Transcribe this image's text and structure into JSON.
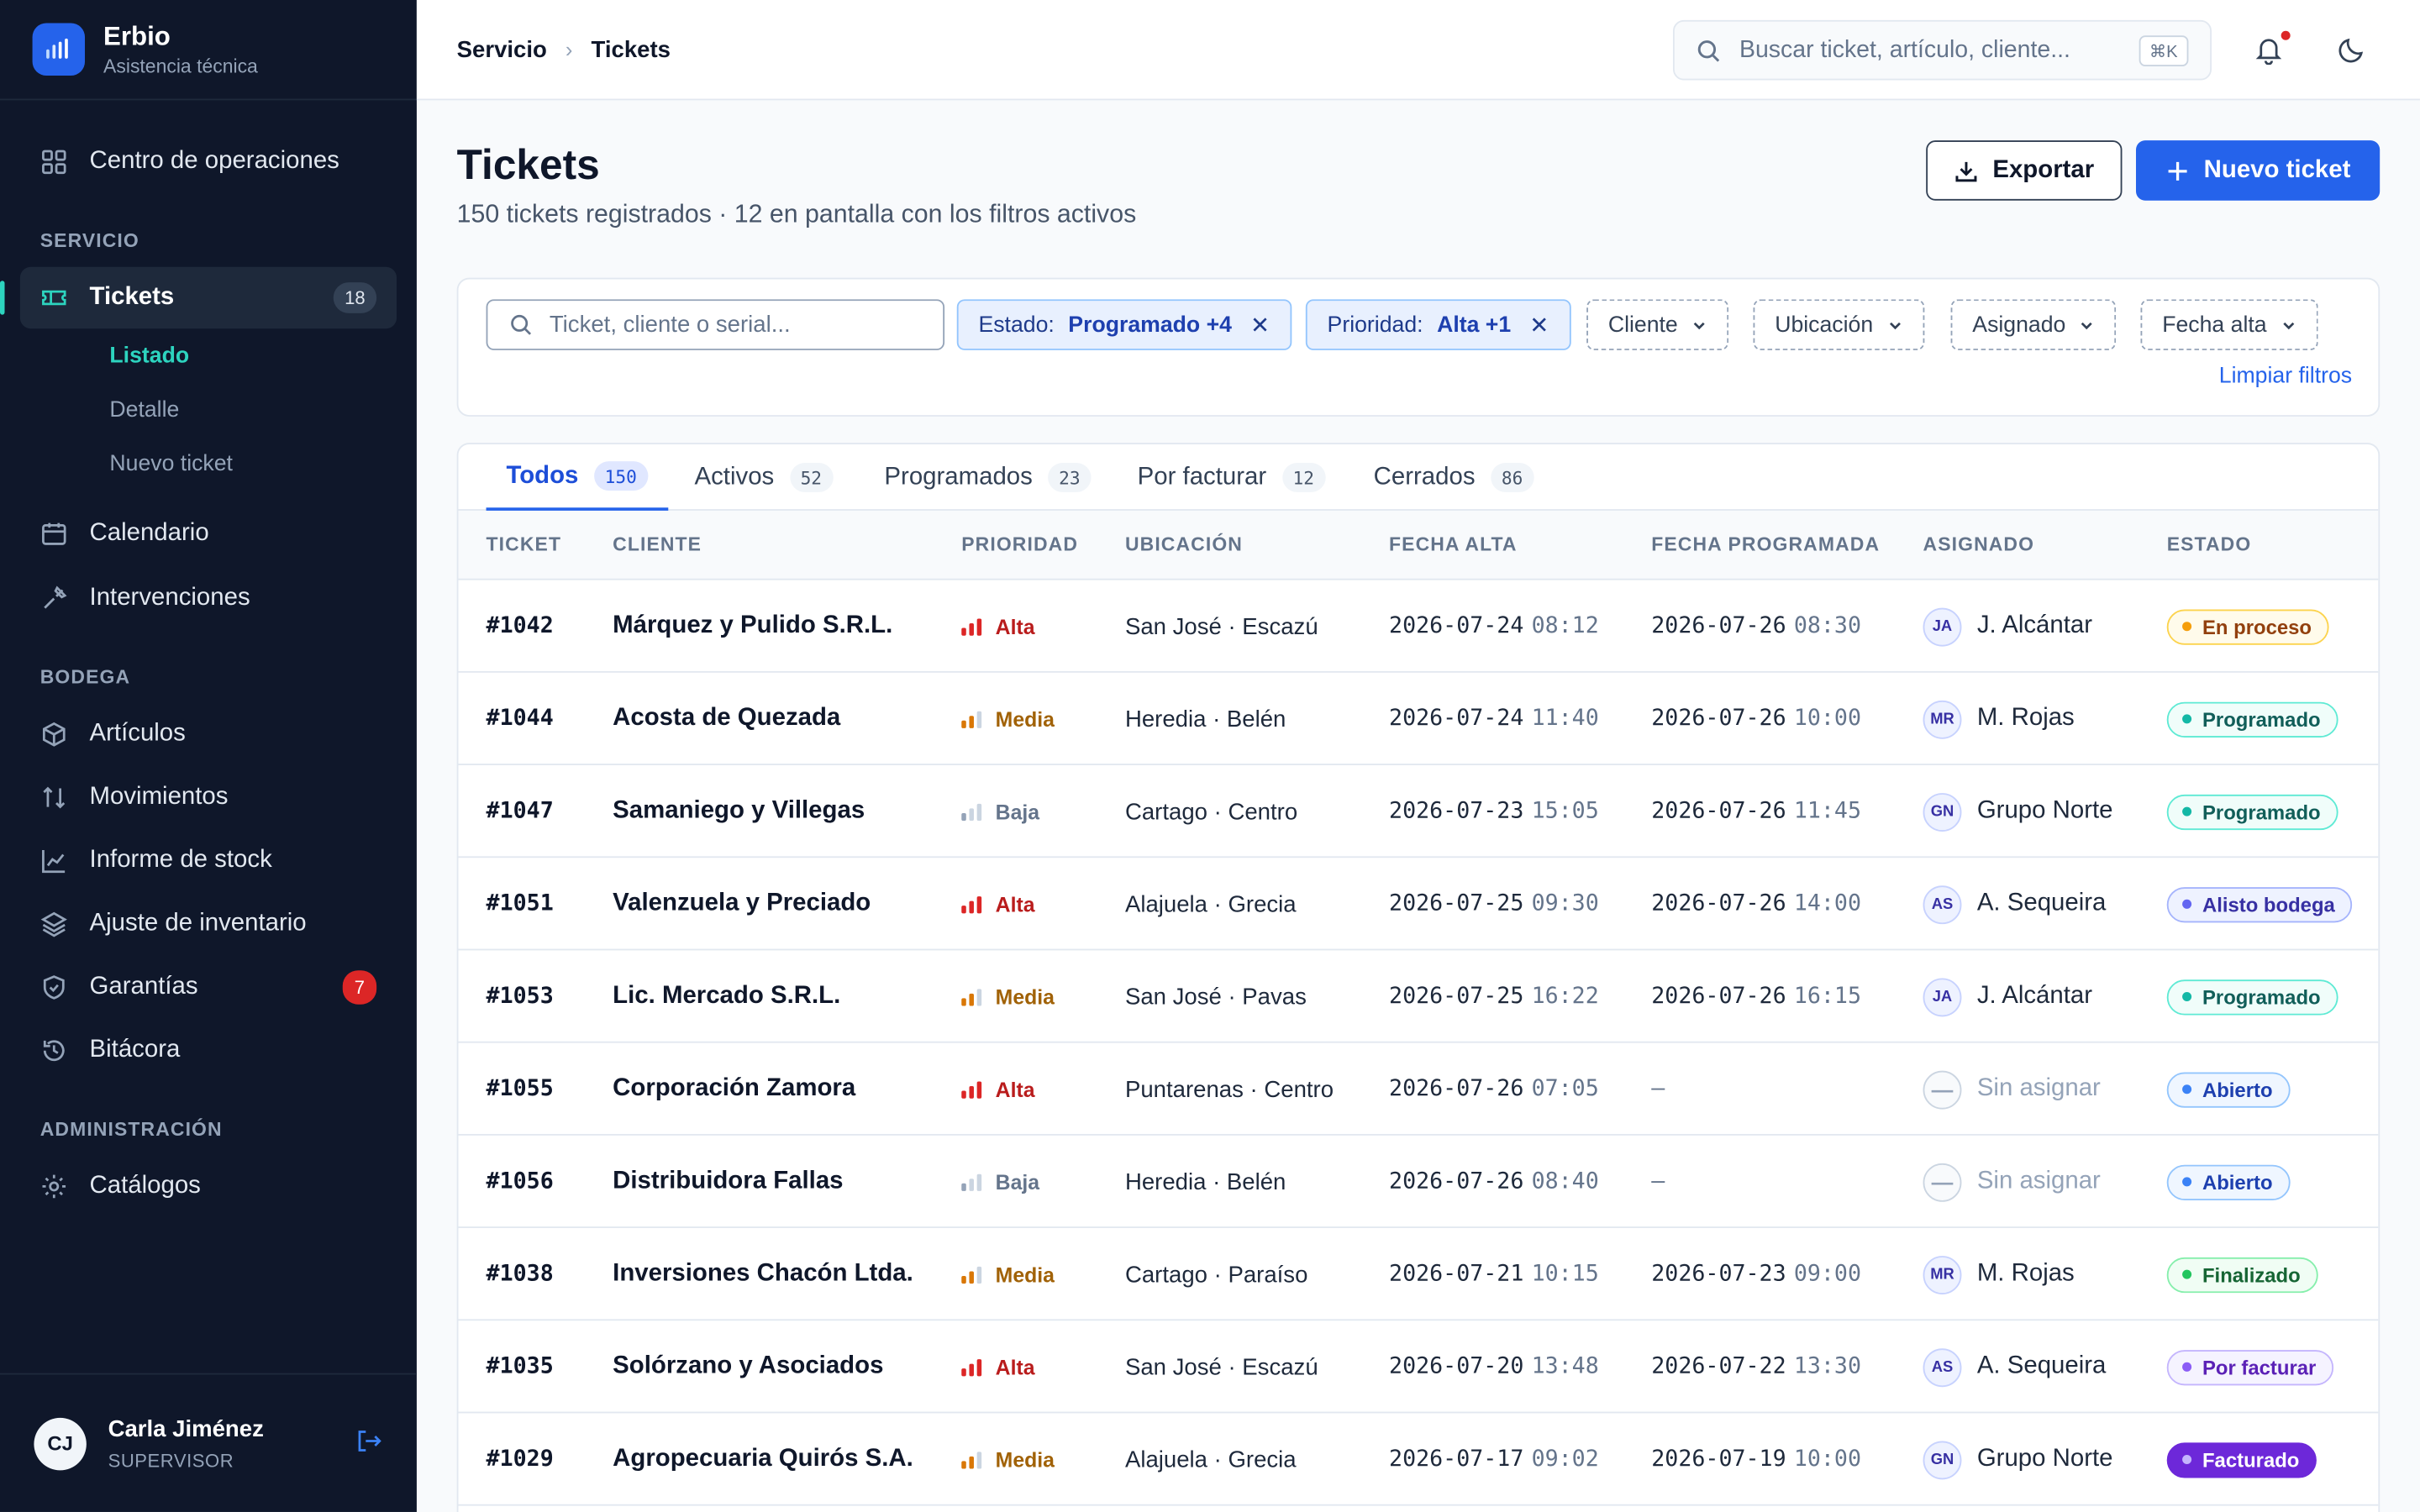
{
  "brand": {
    "name": "Erbio",
    "subtitle": "Asistencia técnica"
  },
  "sidebar": {
    "top_item": {
      "label": "Centro de operaciones",
      "icon": "grid-icon"
    },
    "sections": [
      {
        "title": "SERVICIO"
      },
      {
        "title": "BODEGA"
      },
      {
        "title": "ADMINISTRACIÓN"
      }
    ],
    "tickets": {
      "label": "Tickets",
      "count": "18",
      "icon": "ticket-icon",
      "sub": [
        {
          "label": "Listado"
        },
        {
          "label": "Detalle"
        },
        {
          "label": "Nuevo ticket"
        }
      ]
    },
    "servicio_items": [
      {
        "label": "Calendario",
        "icon": "calendar-icon"
      },
      {
        "label": "Intervenciones",
        "icon": "wrench-icon"
      }
    ],
    "bodega_items": [
      {
        "label": "Artículos",
        "icon": "box-icon"
      },
      {
        "label": "Movimientos",
        "icon": "arrows-updown-icon"
      },
      {
        "label": "Informe de stock",
        "icon": "line-chart-icon"
      },
      {
        "label": "Ajuste de inventario",
        "icon": "layers-icon"
      },
      {
        "label": "Garantías",
        "icon": "shield-icon",
        "badge": "7"
      },
      {
        "label": "Bitácora",
        "icon": "history-icon"
      }
    ],
    "admin_items": [
      {
        "label": "Catálogos",
        "icon": "gear-icon"
      }
    ],
    "user": {
      "initials": "CJ",
      "name": "Carla Jiménez",
      "role": "SUPERVISOR"
    }
  },
  "topbar": {
    "breadcrumb": [
      "Servicio",
      "Tickets"
    ],
    "search_placeholder": "Buscar ticket, artículo, cliente...",
    "shortcut": "⌘K"
  },
  "page": {
    "title": "Tickets",
    "subtitle": "150 tickets registrados · 12 en pantalla con los filtros activos",
    "export_label": "Exportar",
    "new_label": "Nuevo ticket"
  },
  "filters": {
    "search_placeholder": "Ticket, cliente o serial...",
    "active": [
      {
        "label": "Estado:",
        "value": "Programado +4"
      },
      {
        "label": "Prioridad:",
        "value": "Alta +1"
      }
    ],
    "dropdowns": [
      "Cliente",
      "Ubicación",
      "Asignado",
      "Fecha alta"
    ],
    "clear_label": "Limpiar filtros"
  },
  "tabs": [
    {
      "label": "Todos",
      "count": "150",
      "selected": true
    },
    {
      "label": "Activos",
      "count": "52"
    },
    {
      "label": "Programados",
      "count": "23"
    },
    {
      "label": "Por facturar",
      "count": "12"
    },
    {
      "label": "Cerrados",
      "count": "86"
    }
  ],
  "columns": [
    "TICKET",
    "CLIENTE",
    "PRIORIDAD",
    "UBICACIÓN",
    "FECHA ALTA",
    "FECHA PROGRAMADA",
    "ASIGNADO",
    "ESTADO"
  ],
  "colors": {
    "prio_alta": "#b91c1c",
    "prio_media": "#a16207",
    "prio_baja": "#64748b",
    "bar_alta": "#dc2626",
    "bar_media": "#d97706",
    "bar_baja": "#94a3b8"
  },
  "statuses": {
    "En proceso": {
      "bg": "#fffbeb",
      "border": "#fcd34d",
      "fg": "#92400e",
      "dot": "#f59e0b"
    },
    "Programado": {
      "bg": "#f0fdfa",
      "border": "#5eead4",
      "fg": "#115e59",
      "dot": "#14b8a6"
    },
    "Alisto bodega": {
      "bg": "#eef2ff",
      "border": "#a5b4fc",
      "fg": "#3730a3",
      "dot": "#6366f1"
    },
    "Abierto": {
      "bg": "#eff6ff",
      "border": "#93c5fd",
      "fg": "#1e40af",
      "dot": "#3b82f6"
    },
    "Finalizado": {
      "bg": "#f0fdf4",
      "border": "#86efac",
      "fg": "#166534",
      "dot": "#22c55e"
    },
    "Por facturar": {
      "bg": "#f5f3ff",
      "border": "#c4b5fd",
      "fg": "#5b21b6",
      "dot": "#8b5cf6"
    },
    "Facturado": {
      "bg": "#6d28d9",
      "border": "#6d28d9",
      "fg": "#ffffff",
      "dot": "#c4b5fd"
    }
  },
  "rows": [
    {
      "id": "#1042",
      "client": "Márquez y Pulido S.R.L.",
      "priority": "Alta",
      "location": "San José · Escazú",
      "created_date": "2026-07-24",
      "created_time": "08:12",
      "sched_date": "2026-07-26",
      "sched_time": "08:30",
      "initials": "JA",
      "assignee": "J. Alcántar",
      "status": "En proceso"
    },
    {
      "id": "#1044",
      "client": "Acosta de Quezada",
      "priority": "Media",
      "location": "Heredia · Belén",
      "created_date": "2026-07-24",
      "created_time": "11:40",
      "sched_date": "2026-07-26",
      "sched_time": "10:00",
      "initials": "MR",
      "assignee": "M. Rojas",
      "status": "Programado"
    },
    {
      "id": "#1047",
      "client": "Samaniego y Villegas",
      "priority": "Baja",
      "location": "Cartago · Centro",
      "created_date": "2026-07-23",
      "created_time": "15:05",
      "sched_date": "2026-07-26",
      "sched_time": "11:45",
      "initials": "GN",
      "assignee": "Grupo Norte",
      "status": "Programado"
    },
    {
      "id": "#1051",
      "client": "Valenzuela y Preciado",
      "priority": "Alta",
      "location": "Alajuela · Grecia",
      "created_date": "2026-07-25",
      "created_time": "09:30",
      "sched_date": "2026-07-26",
      "sched_time": "14:00",
      "initials": "AS",
      "assignee": "A. Sequeira",
      "status": "Alisto bodega"
    },
    {
      "id": "#1053",
      "client": "Lic. Mercado S.R.L.",
      "priority": "Media",
      "location": "San José · Pavas",
      "created_date": "2026-07-25",
      "created_time": "16:22",
      "sched_date": "2026-07-26",
      "sched_time": "16:15",
      "initials": "JA",
      "assignee": "J. Alcántar",
      "status": "Programado"
    },
    {
      "id": "#1055",
      "client": "Corporación Zamora",
      "priority": "Alta",
      "location": "Puntarenas · Centro",
      "created_date": "2026-07-26",
      "created_time": "07:05",
      "sched_date": "—",
      "sched_time": "",
      "initials": "—",
      "assignee": "Sin asignar",
      "status": "Abierto"
    },
    {
      "id": "#1056",
      "client": "Distribuidora Fallas",
      "priority": "Baja",
      "location": "Heredia · Belén",
      "created_date": "2026-07-26",
      "created_time": "08:40",
      "sched_date": "—",
      "sched_time": "",
      "initials": "—",
      "assignee": "Sin asignar",
      "status": "Abierto"
    },
    {
      "id": "#1038",
      "client": "Inversiones Chacón Ltda.",
      "priority": "Media",
      "location": "Cartago · Paraíso",
      "created_date": "2026-07-21",
      "created_time": "10:15",
      "sched_date": "2026-07-23",
      "sched_time": "09:00",
      "initials": "MR",
      "assignee": "M. Rojas",
      "status": "Finalizado"
    },
    {
      "id": "#1035",
      "client": "Solórzano y Asociados",
      "priority": "Alta",
      "location": "San José · Escazú",
      "created_date": "2026-07-20",
      "created_time": "13:48",
      "sched_date": "2026-07-22",
      "sched_time": "13:30",
      "initials": "AS",
      "assignee": "A. Sequeira",
      "status": "Por facturar"
    },
    {
      "id": "#1029",
      "client": "Agropecuaria Quirós S.A.",
      "priority": "Media",
      "location": "Alajuela · Grecia",
      "created_date": "2026-07-17",
      "created_time": "09:02",
      "sched_date": "2026-07-19",
      "sched_time": "10:00",
      "initials": "GN",
      "assignee": "Grupo Norte",
      "status": "Facturado"
    }
  ]
}
